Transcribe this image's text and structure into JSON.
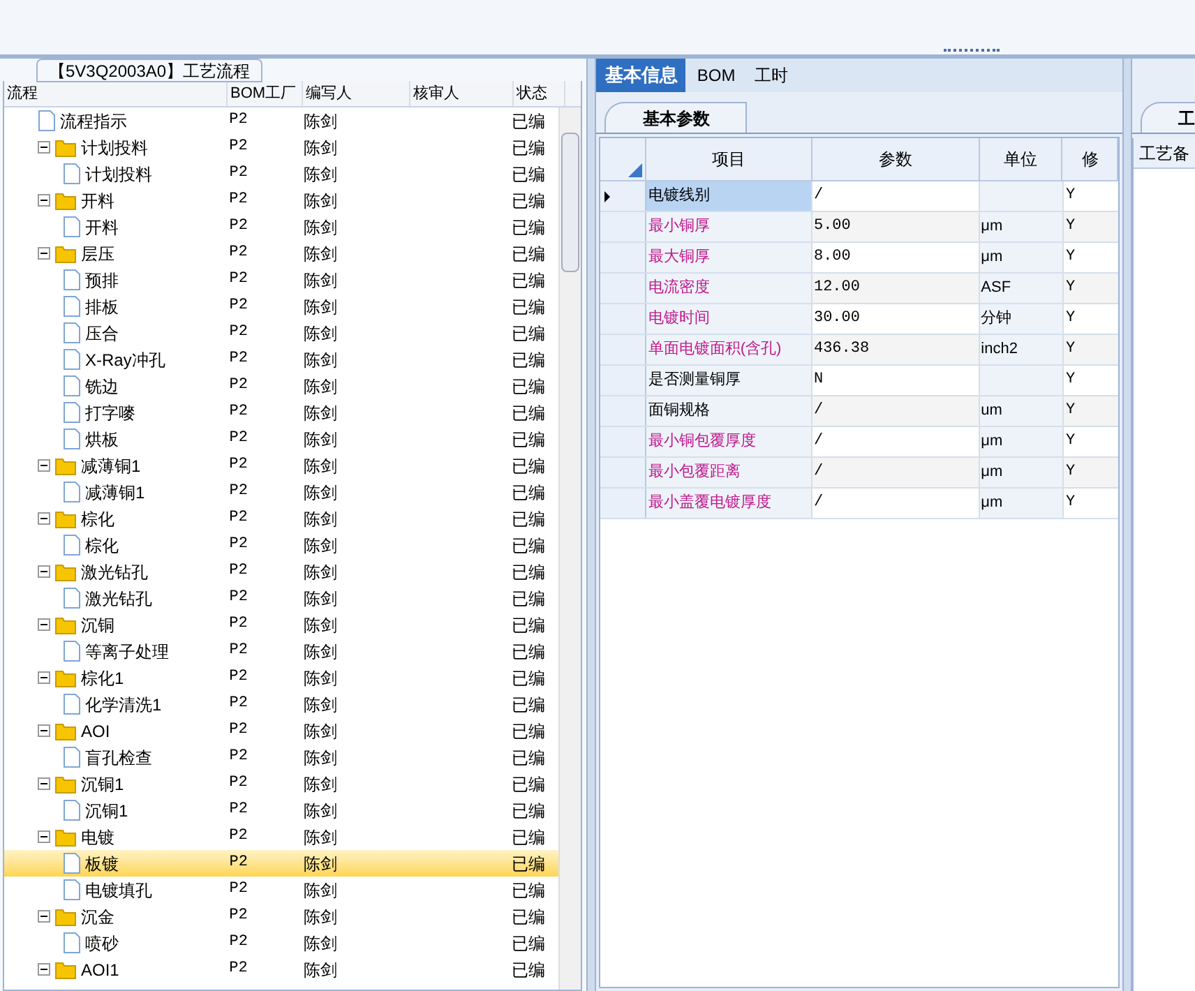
{
  "process_panel": {
    "title": "【5V3Q2003A0】工艺流程",
    "columns": [
      "流程",
      "BOM工厂",
      "编写人",
      "核审人",
      "状态"
    ],
    "tree": [
      {
        "label": "流程指示",
        "kind": "file",
        "bom_factory": "P2",
        "writer": "陈剑",
        "status": "已编",
        "selected": false
      },
      {
        "label": "计划投料",
        "kind": "folder",
        "expanded": true,
        "bom_factory": "P2",
        "writer": "陈剑",
        "status": "已编",
        "selected": false,
        "children": [
          {
            "label": "计划投料",
            "kind": "file",
            "bom_factory": "P2",
            "writer": "陈剑",
            "status": "已编",
            "selected": false
          }
        ]
      },
      {
        "label": "开料",
        "kind": "folder",
        "expanded": true,
        "bom_factory": "P2",
        "writer": "陈剑",
        "status": "已编",
        "selected": false,
        "children": [
          {
            "label": "开料",
            "kind": "file",
            "bom_factory": "P2",
            "writer": "陈剑",
            "status": "已编",
            "selected": false
          }
        ]
      },
      {
        "label": "层压",
        "kind": "folder",
        "expanded": true,
        "bom_factory": "P2",
        "writer": "陈剑",
        "status": "已编",
        "selected": false,
        "children": [
          {
            "label": "预排",
            "kind": "file",
            "bom_factory": "P2",
            "writer": "陈剑",
            "status": "已编",
            "selected": false
          },
          {
            "label": "排板",
            "kind": "file",
            "bom_factory": "P2",
            "writer": "陈剑",
            "status": "已编",
            "selected": false
          },
          {
            "label": "压合",
            "kind": "file",
            "bom_factory": "P2",
            "writer": "陈剑",
            "status": "已编",
            "selected": false
          },
          {
            "label": "X-Ray冲孔",
            "kind": "file",
            "bom_factory": "P2",
            "writer": "陈剑",
            "status": "已编",
            "selected": false
          },
          {
            "label": "铣边",
            "kind": "file",
            "bom_factory": "P2",
            "writer": "陈剑",
            "status": "已编",
            "selected": false
          },
          {
            "label": "打字嘜",
            "kind": "file",
            "bom_factory": "P2",
            "writer": "陈剑",
            "status": "已编",
            "selected": false
          },
          {
            "label": "烘板",
            "kind": "file",
            "bom_factory": "P2",
            "writer": "陈剑",
            "status": "已编",
            "selected": false
          }
        ]
      },
      {
        "label": "减薄铜1",
        "kind": "folder",
        "expanded": true,
        "bom_factory": "P2",
        "writer": "陈剑",
        "status": "已编",
        "selected": false,
        "children": [
          {
            "label": "减薄铜1",
            "kind": "file",
            "bom_factory": "P2",
            "writer": "陈剑",
            "status": "已编",
            "selected": false
          }
        ]
      },
      {
        "label": "棕化",
        "kind": "folder",
        "expanded": true,
        "bom_factory": "P2",
        "writer": "陈剑",
        "status": "已编",
        "selected": false,
        "children": [
          {
            "label": "棕化",
            "kind": "file",
            "bom_factory": "P2",
            "writer": "陈剑",
            "status": "已编",
            "selected": false
          }
        ]
      },
      {
        "label": "激光钻孔",
        "kind": "folder",
        "expanded": true,
        "bom_factory": "P2",
        "writer": "陈剑",
        "status": "已编",
        "selected": false,
        "children": [
          {
            "label": "激光钻孔",
            "kind": "file",
            "bom_factory": "P2",
            "writer": "陈剑",
            "status": "已编",
            "selected": false
          }
        ]
      },
      {
        "label": "沉铜",
        "kind": "folder",
        "expanded": true,
        "bom_factory": "P2",
        "writer": "陈剑",
        "status": "已编",
        "selected": false,
        "children": [
          {
            "label": "等离子处理",
            "kind": "file",
            "bom_factory": "P2",
            "writer": "陈剑",
            "status": "已编",
            "selected": false
          }
        ]
      },
      {
        "label": "棕化1",
        "kind": "folder",
        "expanded": true,
        "bom_factory": "P2",
        "writer": "陈剑",
        "status": "已编",
        "selected": false,
        "children": [
          {
            "label": "化学清洗1",
            "kind": "file",
            "bom_factory": "P2",
            "writer": "陈剑",
            "status": "已编",
            "selected": false
          }
        ]
      },
      {
        "label": "AOI",
        "kind": "folder",
        "expanded": true,
        "bom_factory": "P2",
        "writer": "陈剑",
        "status": "已编",
        "selected": false,
        "children": [
          {
            "label": "盲孔检查",
            "kind": "file",
            "bom_factory": "P2",
            "writer": "陈剑",
            "status": "已编",
            "selected": false
          }
        ]
      },
      {
        "label": "沉铜1",
        "kind": "folder",
        "expanded": true,
        "bom_factory": "P2",
        "writer": "陈剑",
        "status": "已编",
        "selected": false,
        "children": [
          {
            "label": "沉铜1",
            "kind": "file",
            "bom_factory": "P2",
            "writer": "陈剑",
            "status": "已编",
            "selected": false
          }
        ]
      },
      {
        "label": "电镀",
        "kind": "folder",
        "expanded": true,
        "bom_factory": "P2",
        "writer": "陈剑",
        "status": "已编",
        "selected": false,
        "children": [
          {
            "label": "板镀",
            "kind": "file",
            "bom_factory": "P2",
            "writer": "陈剑",
            "status": "已编",
            "selected": true
          },
          {
            "label": "电镀填孔",
            "kind": "file",
            "bom_factory": "P2",
            "writer": "陈剑",
            "status": "已编",
            "selected": false
          }
        ]
      },
      {
        "label": "沉金",
        "kind": "folder",
        "expanded": true,
        "bom_factory": "P2",
        "writer": "陈剑",
        "status": "已编",
        "selected": false,
        "children": [
          {
            "label": "喷砂",
            "kind": "file",
            "bom_factory": "P2",
            "writer": "陈剑",
            "status": "已编",
            "selected": false
          }
        ]
      },
      {
        "label": "AOI1",
        "kind": "folder",
        "expanded": true,
        "bom_factory": "P2",
        "writer": "陈剑",
        "status": "已编",
        "selected": false
      }
    ]
  },
  "tabs": [
    {
      "label": "基本信息",
      "selected": true
    },
    {
      "label": "BOM",
      "selected": false
    },
    {
      "label": "工时",
      "selected": false
    }
  ],
  "subtab": "基本参数",
  "params_table": {
    "columns": [
      "项目",
      "参数",
      "单位",
      "修"
    ],
    "rows": [
      {
        "item": "电镀线别",
        "value": "/",
        "unit": "",
        "modify": "Y",
        "highlighted": false,
        "selected": true
      },
      {
        "item": "最小铜厚",
        "value": "5.00",
        "unit": "μm",
        "modify": "Y",
        "highlighted": true,
        "selected": false
      },
      {
        "item": "最大铜厚",
        "value": "8.00",
        "unit": "μm",
        "modify": "Y",
        "highlighted": true,
        "selected": false
      },
      {
        "item": "电流密度",
        "value": "12.00",
        "unit": "ASF",
        "modify": "Y",
        "highlighted": true,
        "selected": false
      },
      {
        "item": "电镀时间",
        "value": "30.00",
        "unit": "分钟",
        "modify": "Y",
        "highlighted": true,
        "selected": false
      },
      {
        "item": "单面电镀面积(含孔)",
        "value": "436.38",
        "unit": "inch2",
        "modify": "Y",
        "highlighted": true,
        "selected": false
      },
      {
        "item": "是否测量铜厚",
        "value": "N",
        "unit": "",
        "modify": "Y",
        "highlighted": false,
        "selected": false
      },
      {
        "item": "面铜规格",
        "value": "/",
        "unit": "um",
        "modify": "Y",
        "highlighted": false,
        "selected": false
      },
      {
        "item": "最小铜包覆厚度",
        "value": "/",
        "unit": "μm",
        "modify": "Y",
        "highlighted": true,
        "selected": false
      },
      {
        "item": "最小包覆距离",
        "value": "/",
        "unit": "μm",
        "modify": "Y",
        "highlighted": true,
        "selected": false
      },
      {
        "item": "最小盖覆电镀厚度",
        "value": "/",
        "unit": "μm",
        "modify": "Y",
        "highlighted": true,
        "selected": false
      }
    ]
  },
  "notes_panel": {
    "tab": "工",
    "label": "工艺备"
  }
}
